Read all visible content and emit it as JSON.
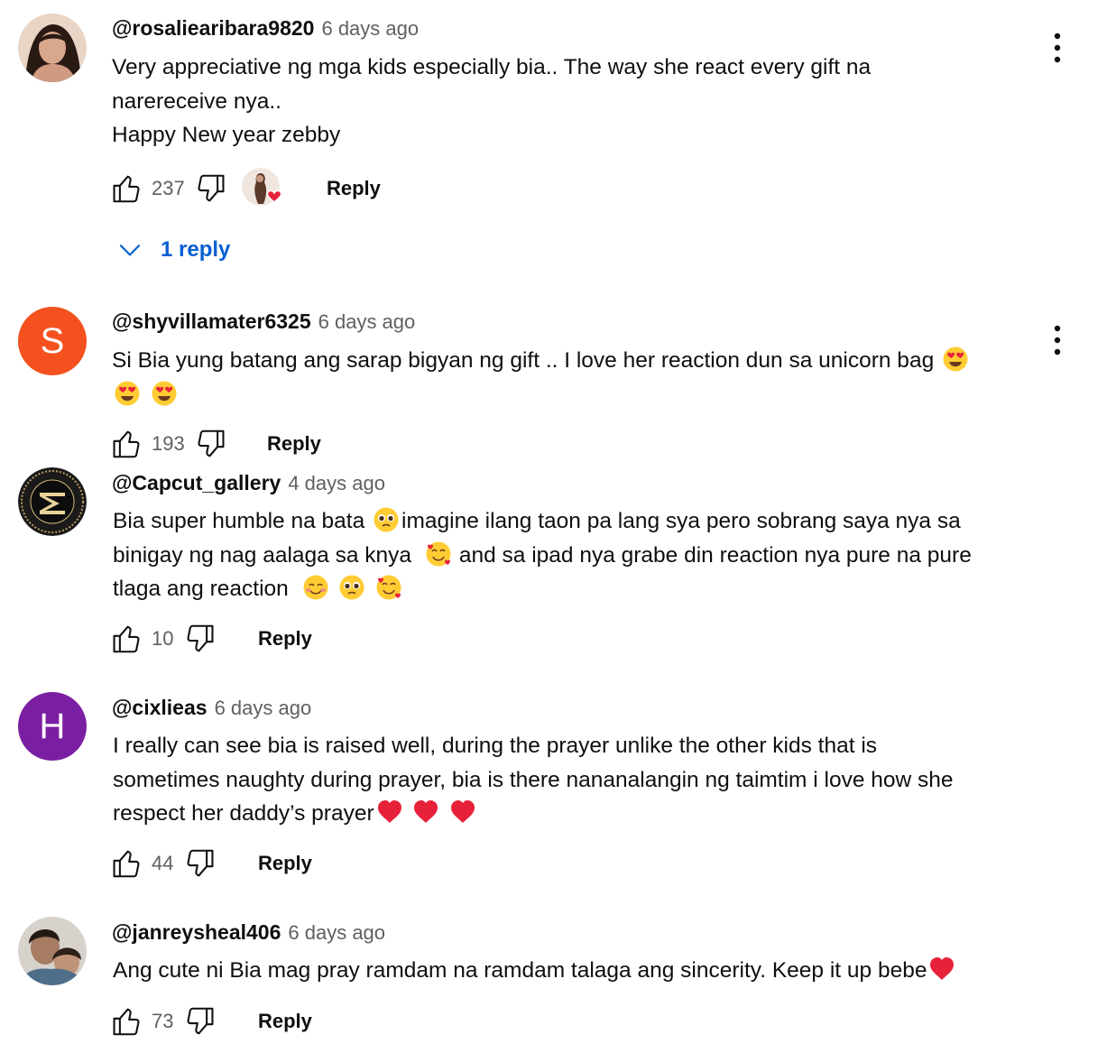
{
  "comments": [
    {
      "author": "@rosaliearibara9820",
      "time": "6 days ago",
      "lines": [
        "Very appreciative ng mga kids especially bia.. The way she react every gift na",
        "narereceive nya..",
        "Happy New year zebby"
      ],
      "likes": "237",
      "reply_label": "Reply",
      "replies_label": "1 reply",
      "creator_hearted": true,
      "avatar": {
        "type": "photo",
        "color": "#b08070"
      }
    },
    {
      "author": "@shyvillamater6325",
      "time": "6 days ago",
      "line1": "Si Bia yung batang ang sarap bigyan ng gift .. I love her reaction dun sa unicorn bag",
      "likes": "193",
      "reply_label": "Reply",
      "avatar": {
        "type": "letter",
        "letter": "S",
        "color": "#f4511e"
      },
      "emojis": [
        "smiling-face-with-heart-eyes",
        "smiling-face-with-heart-eyes",
        "smiling-face-with-heart-eyes"
      ]
    },
    {
      "author": "@Capcut_gallery",
      "time": "4 days ago",
      "seg1": "Bia super humble na bata",
      "seg2": "imagine ilang taon pa lang sya pero sobrang saya nya sa",
      "seg3": "binigay ng nag aalaga sa knya",
      "seg4": "and sa ipad nya grabe din reaction nya pure na pure",
      "seg5": "tlaga ang reaction",
      "likes": "10",
      "reply_label": "Reply",
      "avatar": {
        "type": "logo",
        "color": "#1a1a1a"
      },
      "emojis": [
        "pleading-face",
        "smiling-face-with-hearts",
        "smiling-face",
        "pleading-face",
        "smiling-face-with-hearts"
      ]
    },
    {
      "author": "@cixlieas",
      "time": "6 days ago",
      "lines": [
        "I really can see bia is raised well, during the prayer unlike the other kids that is",
        "sometimes naughty during prayer, bia is there nananalangin ng taimtim i love how she"
      ],
      "line3": "respect her daddy’s prayer",
      "likes": "44",
      "reply_label": "Reply",
      "avatar": {
        "type": "letter",
        "letter": "H",
        "color": "#7b1fa2"
      },
      "emojis": [
        "red-heart",
        "red-heart",
        "red-heart"
      ]
    },
    {
      "author": "@janreysheal406",
      "time": "6 days ago",
      "line1": "Ang cute ni Bia mag pray ramdam na ramdam talaga ang sincerity. Keep it up bebe",
      "likes": "73",
      "reply_label": "Reply",
      "avatar": {
        "type": "photo",
        "color": "#8a7060"
      },
      "emojis": [
        "red-heart"
      ]
    }
  ],
  "colors": {
    "link_blue": "#065fd4",
    "meta_gray": "#606060",
    "heart_red": "#e8213b"
  }
}
